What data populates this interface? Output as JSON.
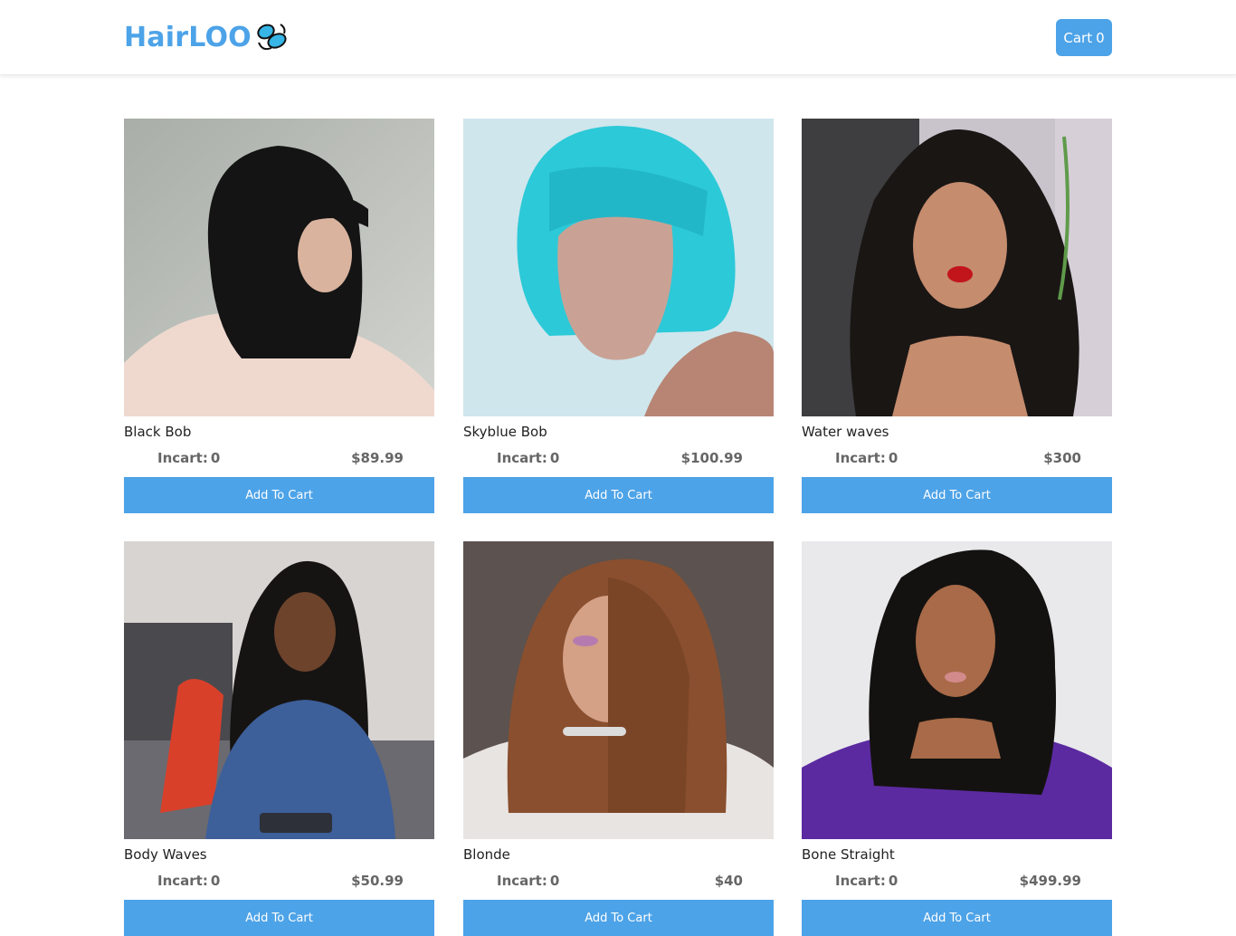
{
  "header": {
    "brand": "HairLOO",
    "cart_label": "Cart",
    "cart_count": "0"
  },
  "products": [
    {
      "name": "Black Bob",
      "incart_label": "Incart:",
      "incart": "0",
      "price": "$89.99",
      "button": "Add To Cart"
    },
    {
      "name": "Skyblue Bob",
      "incart_label": "Incart:",
      "incart": "0",
      "price": "$100.99",
      "button": "Add To Cart"
    },
    {
      "name": "Water waves",
      "incart_label": "Incart:",
      "incart": "0",
      "price": "$300",
      "button": "Add To Cart"
    },
    {
      "name": "Body Waves",
      "incart_label": "Incart:",
      "incart": "0",
      "price": "$50.99",
      "button": "Add To Cart"
    },
    {
      "name": "Blonde",
      "incart_label": "Incart:",
      "incart": "0",
      "price": "$40",
      "button": "Add To Cart"
    },
    {
      "name": "Bone Straight",
      "incart_label": "Incart:",
      "incart": "0",
      "price": "$499.99",
      "button": "Add To Cart"
    }
  ],
  "colors": {
    "accent": "#4da3e8",
    "price_text": "#666666"
  },
  "icons": {
    "brand": "butterfly-icon"
  }
}
